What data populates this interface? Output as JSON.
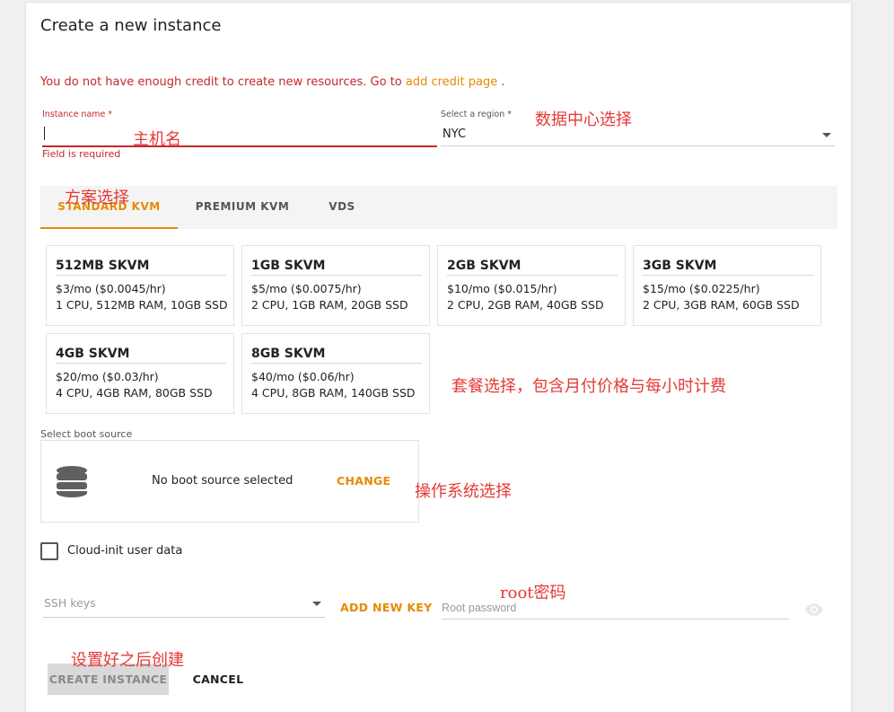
{
  "page_title": "Create a new instance",
  "credit_warning": {
    "prefix": "You do not have enough credit to create new resources. Go to ",
    "link": "add credit page",
    "suffix": " ."
  },
  "instance_name": {
    "label": "Instance name *",
    "value": "",
    "error": "Field is required"
  },
  "region": {
    "label": "Select a region *",
    "selected": "NYC"
  },
  "tabs": [
    {
      "label": "STANDARD KVM",
      "active": true
    },
    {
      "label": "PREMIUM KVM",
      "active": false
    },
    {
      "label": "VDS",
      "active": false
    }
  ],
  "plans": [
    {
      "name": "512MB SKVM",
      "price": "$3/mo ($0.0045/hr)",
      "spec": "1 CPU, 512MB RAM, 10GB SSD"
    },
    {
      "name": "1GB SKVM",
      "price": "$5/mo ($0.0075/hr)",
      "spec": "2 CPU, 1GB RAM, 20GB SSD"
    },
    {
      "name": "2GB SKVM",
      "price": "$10/mo ($0.015/hr)",
      "spec": "2 CPU, 2GB RAM, 40GB SSD"
    },
    {
      "name": "3GB SKVM",
      "price": "$15/mo ($0.0225/hr)",
      "spec": "2 CPU, 3GB RAM, 60GB SSD"
    },
    {
      "name": "4GB SKVM",
      "price": "$20/mo ($0.03/hr)",
      "spec": "4 CPU, 4GB RAM, 80GB SSD"
    },
    {
      "name": "8GB SKVM",
      "price": "$40/mo ($0.06/hr)",
      "spec": "4 CPU, 8GB RAM, 140GB SSD"
    }
  ],
  "boot_source": {
    "label": "Select boot source",
    "status": "No boot source selected",
    "change_label": "CHANGE",
    "icon": "database-icon"
  },
  "cloud_init": {
    "label": "Cloud-init user data",
    "checked": false
  },
  "ssh_keys": {
    "placeholder": "SSH keys",
    "add_label": "ADD NEW KEY"
  },
  "root_password": {
    "placeholder": "Root password",
    "icon": "eye-icon"
  },
  "actions": {
    "create_label": "CREATE INSTANCE",
    "cancel_label": "CANCEL"
  },
  "annotations": {
    "hostname": "主机名",
    "datacenter": "数据中心选择",
    "plan_type": "方案选择",
    "package": "套餐选择，包含月付价格与每小时计费",
    "os": "操作系统选择",
    "root_pw": "root密码",
    "create": "设置好之后创建"
  },
  "colors": {
    "accent": "#e68a00",
    "error": "#c62828",
    "annotation": "#e53935"
  }
}
